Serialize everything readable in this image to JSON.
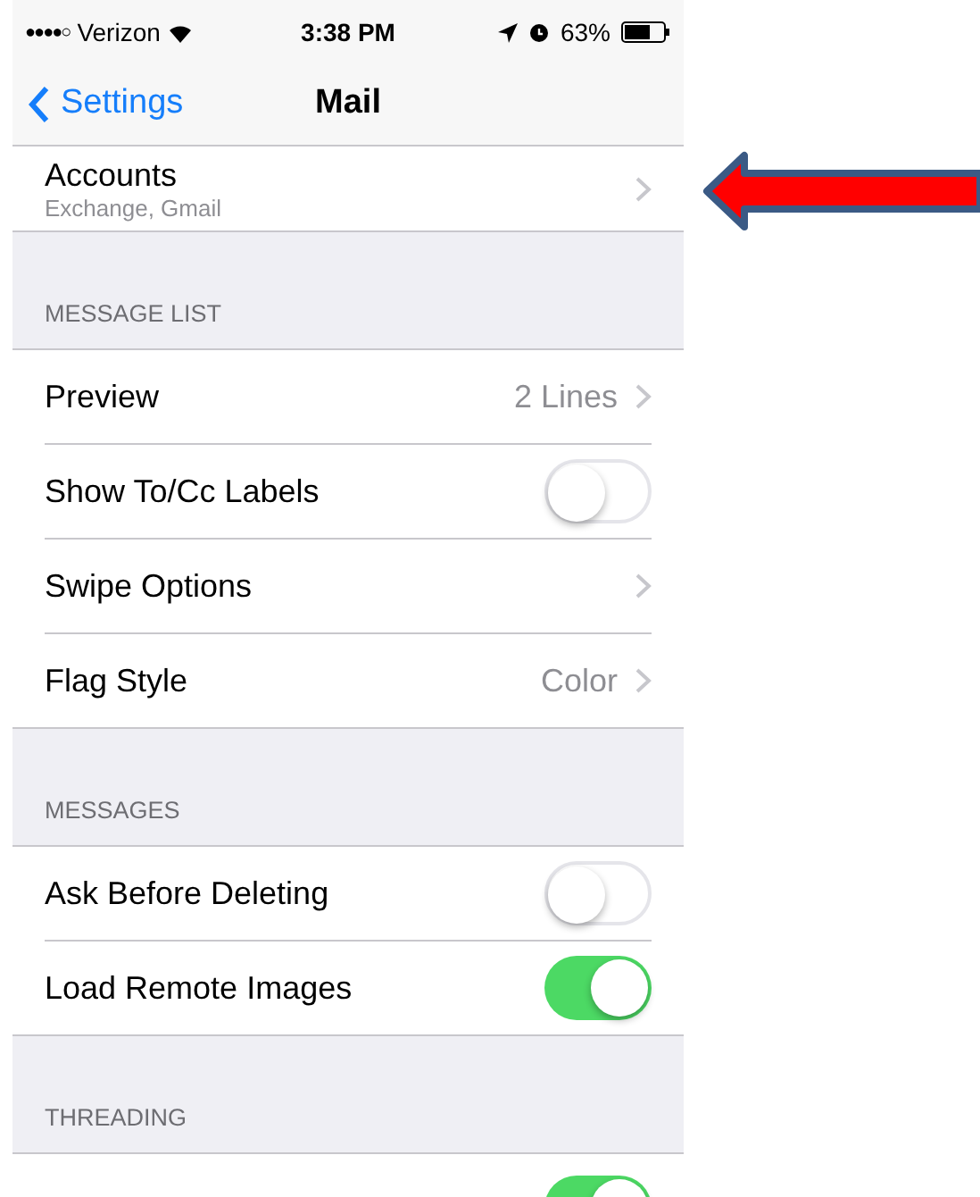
{
  "status_bar": {
    "signal_dots": "●●●●○",
    "carrier": "Verizon",
    "time": "3:38 PM",
    "battery": "63%"
  },
  "nav": {
    "back": "Settings",
    "title": "Mail"
  },
  "sections": [
    {
      "rows": [
        {
          "kind": "link",
          "label": "Accounts",
          "subtitle": "Exchange, Gmail"
        }
      ]
    },
    {
      "header": "MESSAGE LIST",
      "rows": [
        {
          "kind": "link",
          "label": "Preview",
          "value": "2 Lines"
        },
        {
          "kind": "toggle",
          "label": "Show To/Cc Labels",
          "on": false
        },
        {
          "kind": "link",
          "label": "Swipe Options"
        },
        {
          "kind": "link",
          "label": "Flag Style",
          "value": "Color"
        }
      ]
    },
    {
      "header": "MESSAGES",
      "rows": [
        {
          "kind": "toggle",
          "label": "Ask Before Deleting",
          "on": false
        },
        {
          "kind": "toggle",
          "label": "Load Remote Images",
          "on": true
        }
      ]
    },
    {
      "header": "THREADING",
      "rows": [
        {
          "kind": "toggle",
          "on": true
        }
      ]
    }
  ]
}
